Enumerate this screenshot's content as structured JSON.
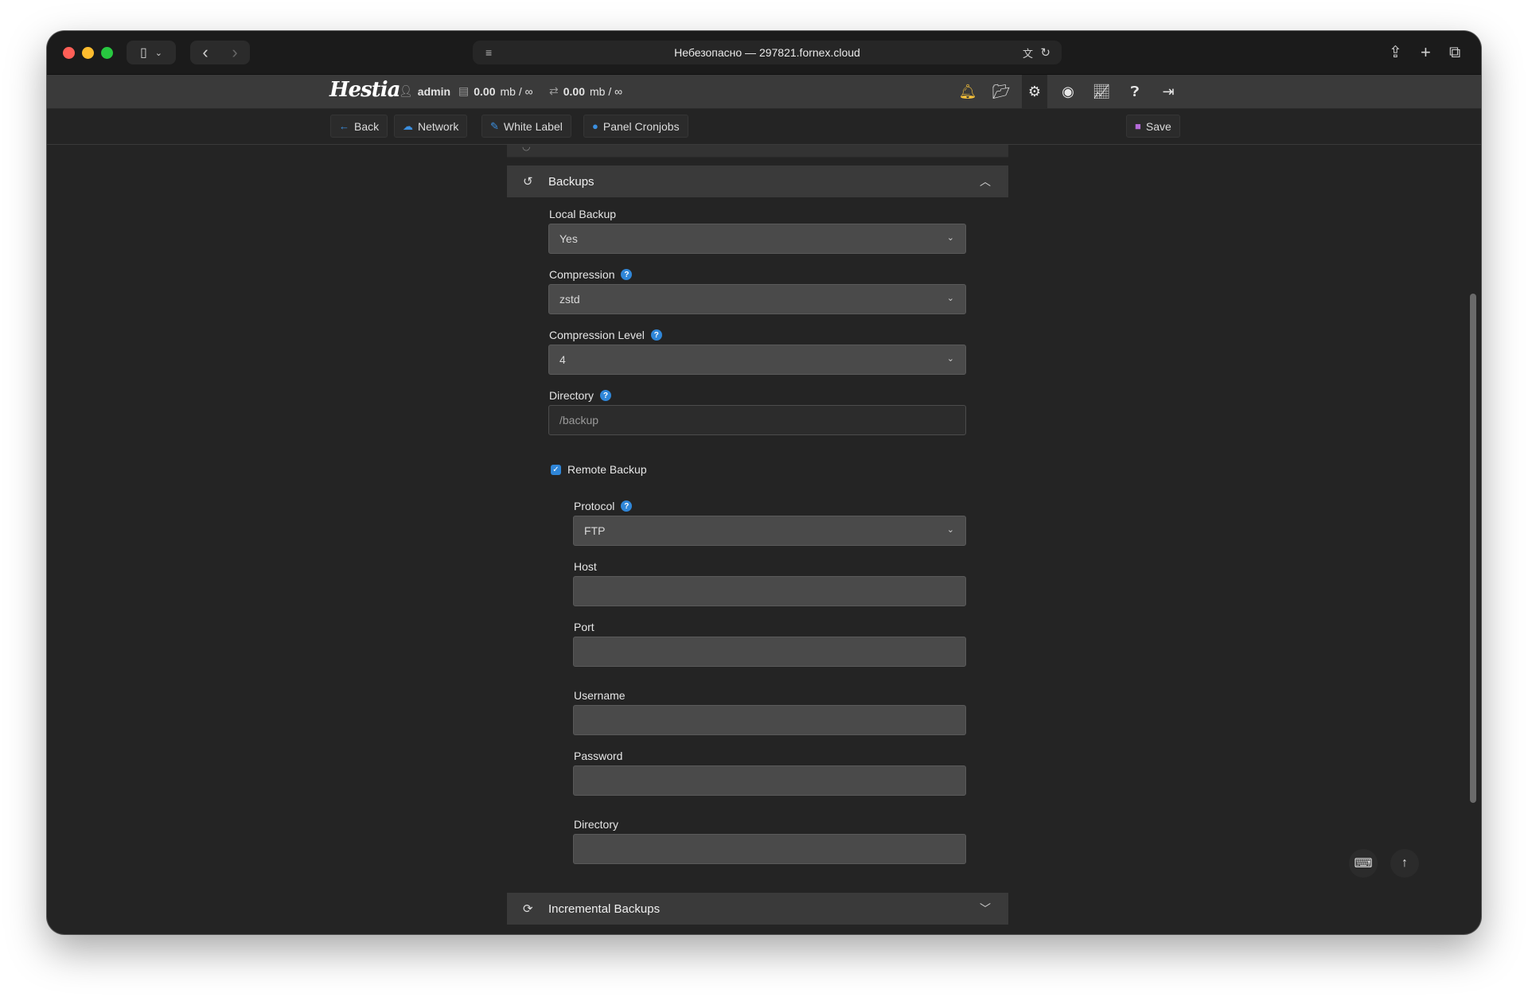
{
  "browser": {
    "address": "Небезопасно — 297821.fornex.cloud",
    "reader_icon": "reader-icon",
    "translate_icon": "translate-icon",
    "reload_icon": "reload-icon"
  },
  "header": {
    "logo": "Hestia",
    "user": "admin",
    "disk_value": "0.00",
    "disk_unit": "mb / ∞",
    "bandwidth_value": "0.00",
    "bandwidth_unit": "mb / ∞",
    "icons": [
      "bell-icon",
      "folder-icon",
      "gear-icon",
      "user-circle-icon",
      "chart-icon",
      "help-icon",
      "logout-icon"
    ]
  },
  "toolbar": {
    "back_label": "Back",
    "network_label": "Network",
    "whitelabel_label": "White Label",
    "cronjobs_label": "Panel Cronjobs",
    "save_label": "Save"
  },
  "backups": {
    "title": "Backups",
    "local_backup_label": "Local Backup",
    "local_backup_value": "Yes",
    "compression_label": "Compression",
    "compression_value": "zstd",
    "compression_level_label": "Compression Level",
    "compression_level_value": "4",
    "directory_label": "Directory",
    "directory_placeholder": "/backup",
    "remote_backup_label": "Remote Backup",
    "remote_backup_checked": true,
    "protocol_label": "Protocol",
    "protocol_value": "FTP",
    "host_label": "Host",
    "port_label": "Port",
    "username_label": "Username",
    "password_label": "Password",
    "remote_directory_label": "Directory"
  },
  "incremental": {
    "title": "Incremental Backups"
  },
  "colors": {
    "accent": "#2f86d8",
    "background": "#242424",
    "section_header": "#3a3a3a"
  }
}
